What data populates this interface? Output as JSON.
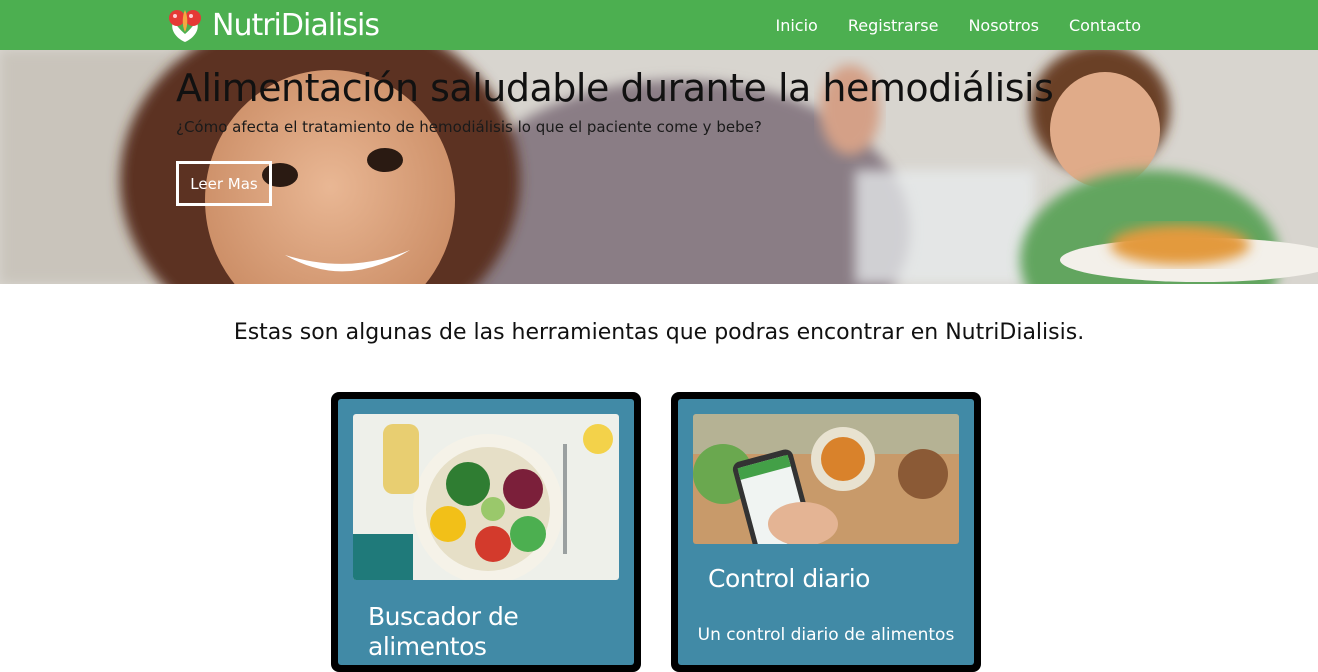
{
  "navbar": {
    "brand": "NutriDialisis",
    "links": [
      "Inicio",
      "Registrarse",
      "Nosotros",
      "Contacto"
    ],
    "bg_color": "#4caf50"
  },
  "hero": {
    "title": "Alimentación saludable durante la hemodiálisis",
    "subtitle": "¿Cómo afecta el tratamiento de hemodiálisis lo que el paciente come y bebe?",
    "button_label": "Leer Mas"
  },
  "section": {
    "intro": "Estas son algunas de las herramientas que podras encontrar en NutriDialisis.",
    "cards": [
      {
        "title": "Buscador de alimentos",
        "text": ""
      },
      {
        "title": "Control diario",
        "text": "Un control diario de alimentos"
      }
    ],
    "card_color": "#418aa6"
  }
}
